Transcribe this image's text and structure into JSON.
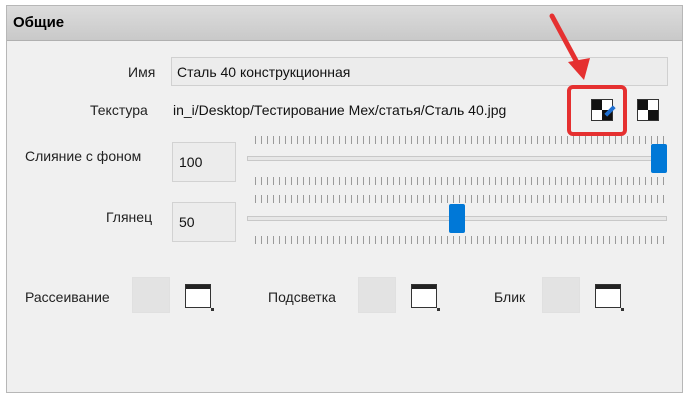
{
  "section": {
    "title": "Общие"
  },
  "name": {
    "label": "Имя",
    "value": "Сталь 40 конструкционная"
  },
  "texture": {
    "label": "Текстура",
    "path": "in_i/Desktop/Тестирование Мех/статья/Сталь 40.jpg",
    "edit_icon": "texture-edit-icon",
    "browse_icon": "texture-browse-icon"
  },
  "blend": {
    "label": "Слияние с фоном",
    "value": "100",
    "level": 1.0
  },
  "gloss": {
    "label": "Глянец",
    "value": "50",
    "level": 0.5
  },
  "colors": {
    "diffuse": {
      "label": "Рассеивание"
    },
    "glow": {
      "label": "Подсветка"
    },
    "specular": {
      "label": "Блик"
    }
  },
  "annotation_color": "#e53030",
  "accent_color": "#0078d7"
}
